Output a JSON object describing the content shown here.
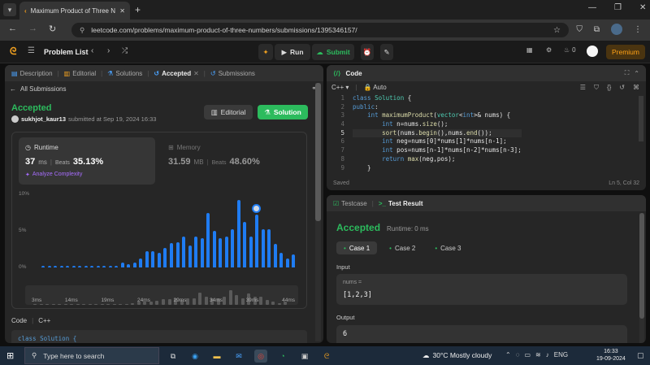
{
  "browser": {
    "tab_title": "Maximum Product of Three Nu",
    "url": "leetcode.com/problems/maximum-product-of-three-numbers/submissions/1395346157/"
  },
  "nav": {
    "problem_list": "Problem List",
    "run": "Run",
    "submit": "Submit",
    "streak": "0",
    "premium": "Premium"
  },
  "left_tabs": {
    "description": "Description",
    "editorial": "Editorial",
    "solutions": "Solutions",
    "accepted": "Accepted",
    "submissions": "Submissions"
  },
  "submission": {
    "back": "All Submissions",
    "status": "Accepted",
    "user": "sukhjot_kaur13",
    "submitted": "submitted at Sep 19, 2024 16:33",
    "editorial_btn": "Editorial",
    "solution_btn": "Solution",
    "runtime_label": "Runtime",
    "runtime_value": "37",
    "runtime_unit": "ms",
    "beats_label": "Beats",
    "runtime_beats": "35.13%",
    "analyze": "Analyze Complexity",
    "memory_label": "Memory",
    "memory_value": "31.59",
    "memory_unit": "MB",
    "memory_beats": "48.60%"
  },
  "chart_data": {
    "type": "bar",
    "y_ticks": [
      "10%",
      "5%",
      "0%"
    ],
    "x_ticks": [
      "3ms",
      "14ms",
      "19ms",
      "24ms",
      "29ms",
      "34ms",
      "39ms",
      "44ms"
    ],
    "ylim": [
      0,
      10
    ],
    "values": [
      0.2,
      0.2,
      0.2,
      0.2,
      0.2,
      0.2,
      0.2,
      0.2,
      0.2,
      0.2,
      0.2,
      0.2,
      0.2,
      0.7,
      0.4,
      0.7,
      1.2,
      2.2,
      2.2,
      2.0,
      2.7,
      3.3,
      3.5,
      4.2,
      3.0,
      4.2,
      4.0,
      7.4,
      5.0,
      4.0,
      4.2,
      5.2,
      9.2,
      6.2,
      4.2,
      7.2,
      5.2,
      5.2,
      3.2,
      2.0,
      1.2,
      1.8
    ],
    "selected_index": 35
  },
  "left_footer": {
    "code_label": "Code",
    "lang": "C++",
    "code_preview": "class Solution {"
  },
  "code_panel": {
    "title": "Code",
    "lang": "C++",
    "auto": "Auto",
    "saved": "Saved",
    "cursor": "Ln 5, Col 32",
    "lines": [
      "class Solution {",
      "public:",
      "    int maximumProduct(vector<int>& nums) {",
      "        int n=nums.size();",
      "        sort(nums.begin(),nums.end());",
      "        int neg=nums[0]*nums[1]*nums[n-1];",
      "        int pos=nums[n-1]*nums[n-2]*nums[n-3];",
      "        return max(neg,pos);",
      "    }"
    ]
  },
  "test_panel": {
    "testcase": "Testcase",
    "result": "Test Result",
    "status": "Accepted",
    "runtime": "Runtime: 0 ms",
    "case1": "Case 1",
    "case2": "Case 2",
    "case3": "Case 3",
    "input_label": "Input",
    "var_name": "nums =",
    "var_value": "[1,2,3]",
    "output_label": "Output",
    "output_value": "6"
  },
  "taskbar": {
    "search": "Type here to search",
    "weather": "30°C  Mostly cloudy",
    "lang": "ENG",
    "time": "16:33",
    "date": "19-09-2024"
  }
}
